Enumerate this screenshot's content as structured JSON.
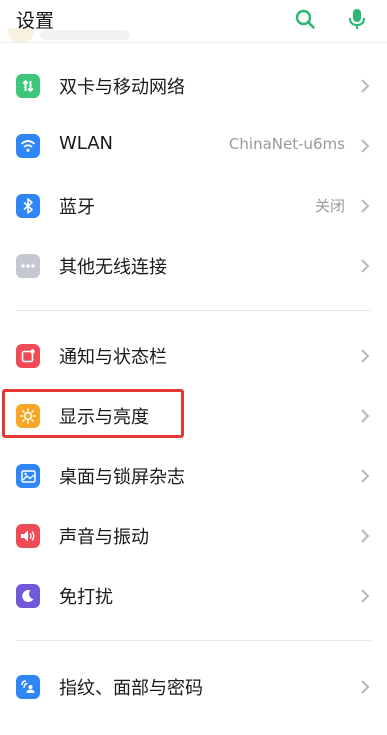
{
  "header": {
    "title": "设置",
    "search_icon": "search-icon",
    "mic_icon": "microphone-icon",
    "accent": "#2bb673"
  },
  "sections": [
    {
      "items": [
        {
          "id": "sim-network",
          "label": "双卡与移动网络",
          "value": "",
          "icon": "sim-network-icon",
          "color": "#3cc77a"
        },
        {
          "id": "wlan",
          "label": "WLAN",
          "value": "ChinaNet-u6ms",
          "icon": "wifi-icon",
          "color": "#2f86f6"
        },
        {
          "id": "bluetooth",
          "label": "蓝牙",
          "value": "关闭",
          "icon": "bluetooth-icon",
          "color": "#2f86f6"
        },
        {
          "id": "other-wireless",
          "label": "其他无线连接",
          "value": "",
          "icon": "more-dots-icon",
          "color": "#c5c8d0"
        }
      ]
    },
    {
      "items": [
        {
          "id": "notifications",
          "label": "通知与状态栏",
          "value": "",
          "icon": "notification-icon",
          "color": "#ef4a55"
        },
        {
          "id": "display",
          "label": "显示与亮度",
          "value": "",
          "icon": "brightness-icon",
          "color": "#f6a623",
          "highlighted": true
        },
        {
          "id": "wallpaper",
          "label": "桌面与锁屏杂志",
          "value": "",
          "icon": "wallpaper-icon",
          "color": "#2f86f6"
        },
        {
          "id": "sound",
          "label": "声音与振动",
          "value": "",
          "icon": "speaker-icon",
          "color": "#ef4a55"
        },
        {
          "id": "dnd",
          "label": "免打扰",
          "value": "",
          "icon": "moon-icon",
          "color": "#7058d8"
        }
      ]
    },
    {
      "items": [
        {
          "id": "biometrics",
          "label": "指纹、面部与密码",
          "value": "",
          "icon": "fingerprint-face-icon",
          "color": "#2f86f6"
        }
      ]
    }
  ],
  "highlight_color": "#e53935"
}
